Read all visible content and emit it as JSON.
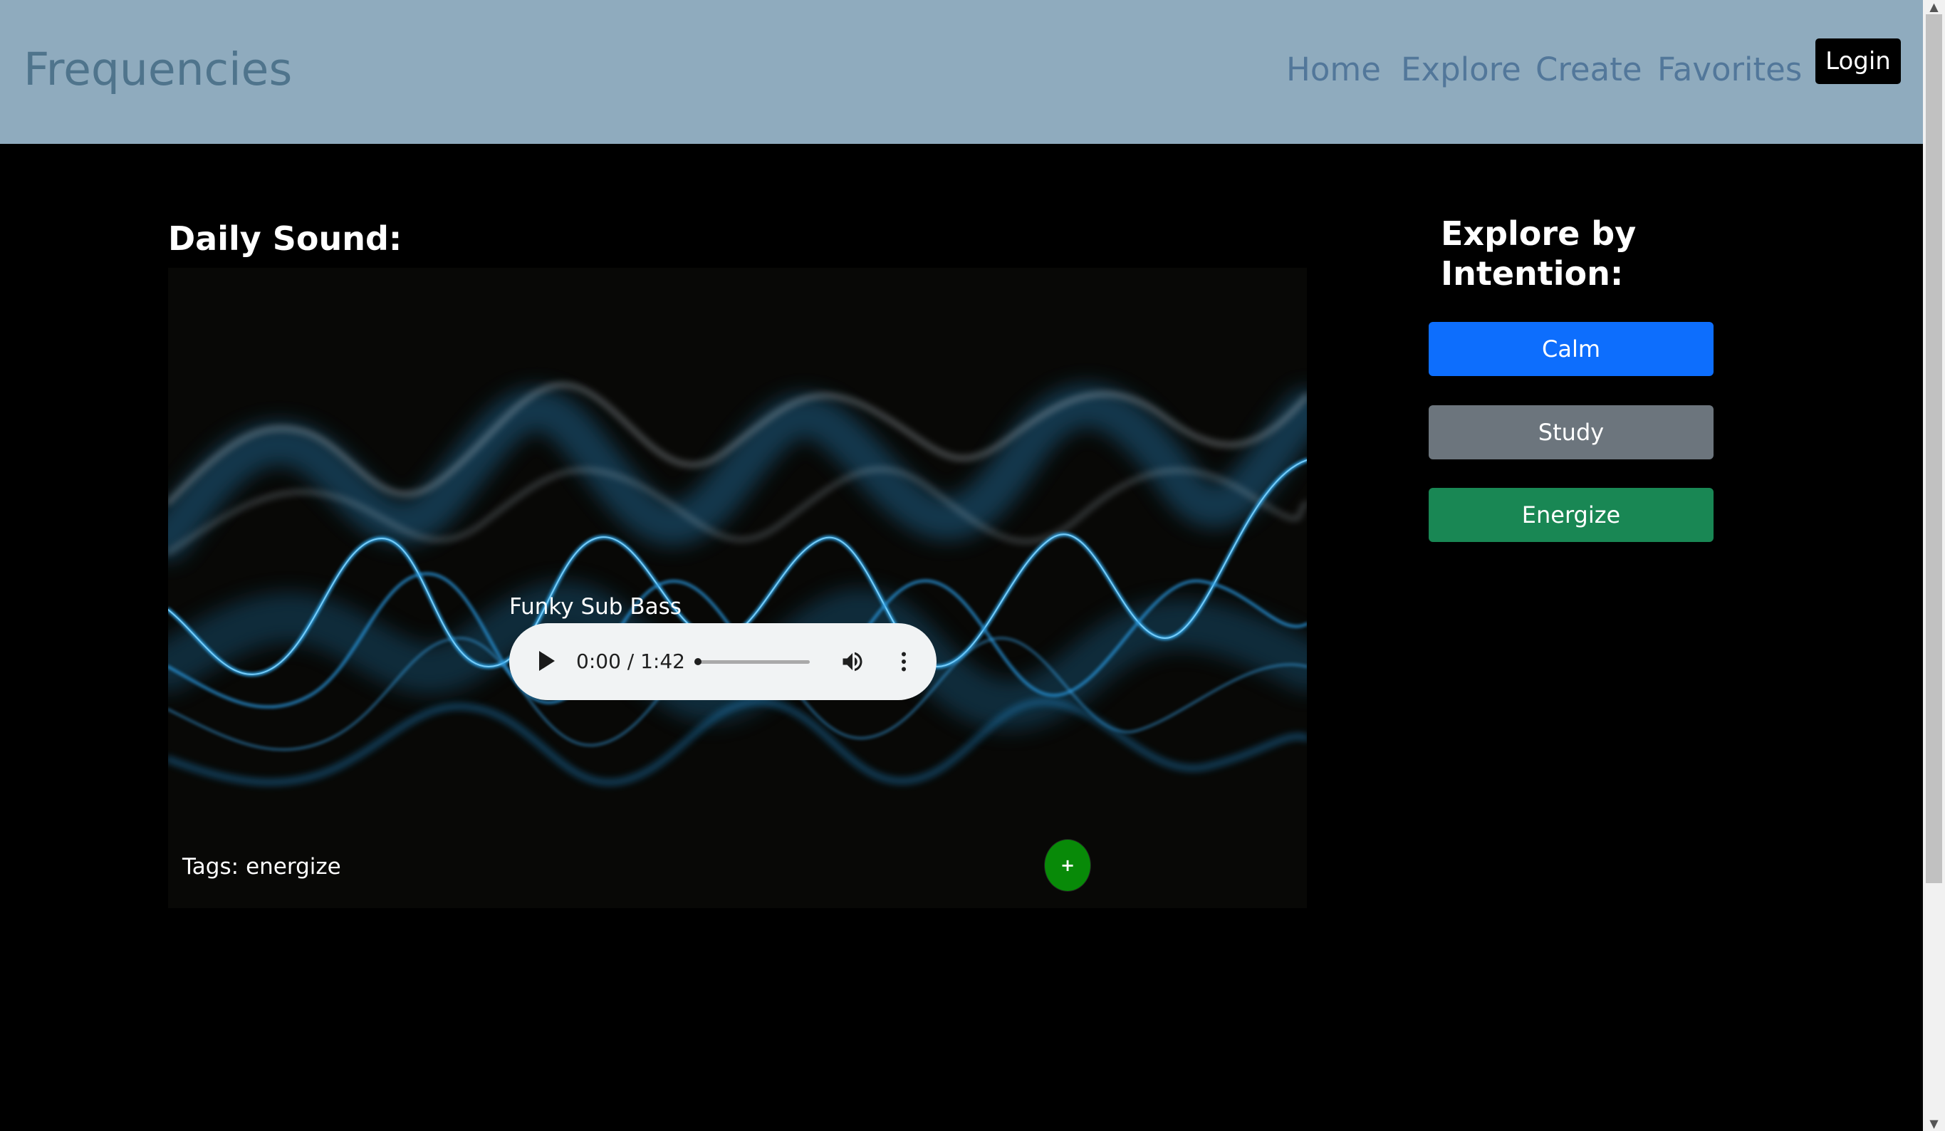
{
  "header": {
    "brand": "Frequencies",
    "nav": {
      "home": "Home",
      "explore": "Explore",
      "create": "Create",
      "favorites": "Favorites"
    },
    "login_label": "Login"
  },
  "daily_sound": {
    "title": "Daily Sound:",
    "track_title": "Funky Sub Bass",
    "player": {
      "time": "0:00 / 1:42",
      "progress": 0,
      "play_icon": "play-icon",
      "volume_icon": "volume-icon",
      "menu_icon": "more-vertical-icon"
    },
    "tags_label": "Tags:",
    "tags_value": "energize",
    "add_label": "+"
  },
  "explore": {
    "title": "Explore by Intention:",
    "buttons": {
      "calm": "Calm",
      "study": "Study",
      "energize": "Energize"
    }
  },
  "colors": {
    "navbar": "#8fabbe",
    "calm": "#0d6efd",
    "study": "#6c757d",
    "energize": "#198754",
    "add_button": "#088a08"
  }
}
